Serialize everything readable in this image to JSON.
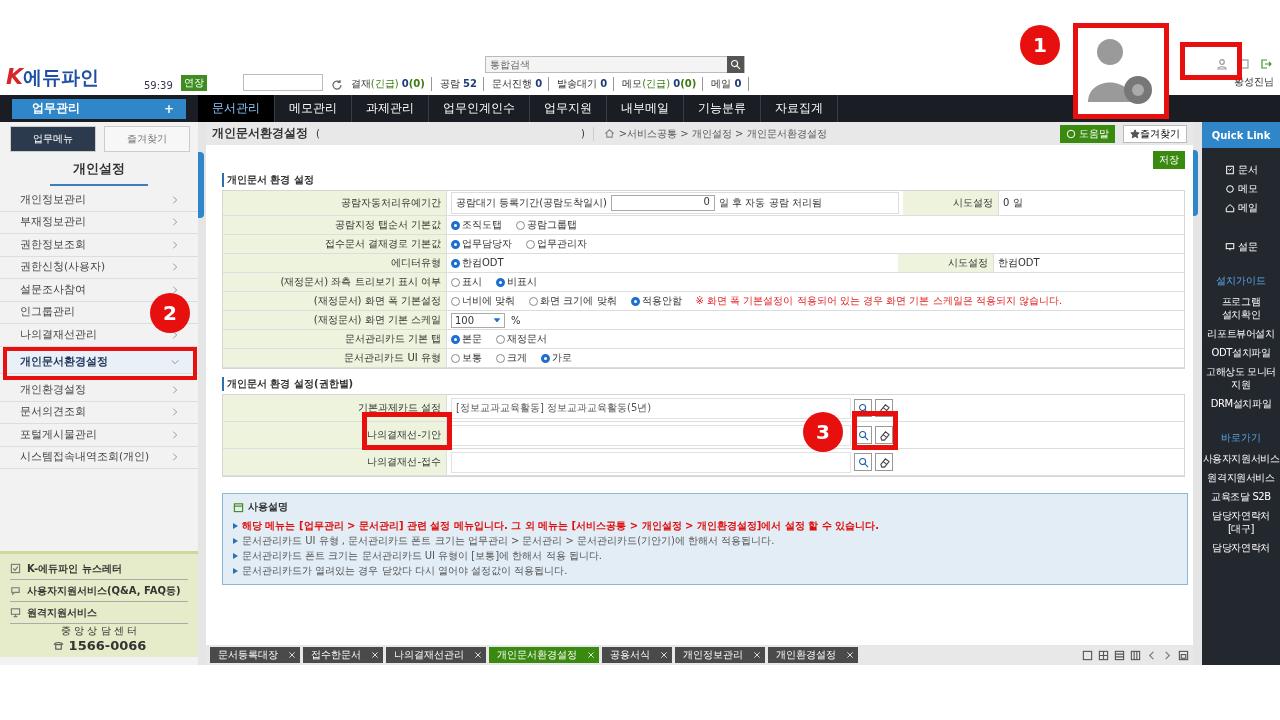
{
  "header": {
    "logo_k": "K",
    "logo": "에듀파인",
    "timer": "59:39",
    "extend": "연장",
    "search_placeholder": "통합검색",
    "status": [
      {
        "label": "결재",
        "urgent": "(긴급)",
        "count": "0",
        "sub": "(0)"
      },
      {
        "label": "공람",
        "count": "52"
      },
      {
        "label": "문서진행",
        "count": "0"
      },
      {
        "label": "발송대기",
        "count": "0"
      },
      {
        "label": "메모",
        "urgent": "(긴급)",
        "count": "0",
        "sub": "(0)"
      },
      {
        "label": "메일",
        "count": "0"
      }
    ],
    "user": "황성진님"
  },
  "nav": {
    "main_button": "업무관리",
    "plus": "+",
    "items": [
      {
        "label": "문서관리",
        "selected": true
      },
      {
        "label": "메모관리",
        "selected": false
      },
      {
        "label": "과제관리",
        "selected": false
      },
      {
        "label": "업무인계인수",
        "selected": false
      },
      {
        "label": "업무지원",
        "selected": false
      },
      {
        "label": "내부메일",
        "selected": false
      },
      {
        "label": "기능분류",
        "selected": false
      },
      {
        "label": "자료집계",
        "selected": false
      }
    ]
  },
  "sidebar": {
    "tabs": [
      {
        "label": "업무메뉴",
        "selected": true
      },
      {
        "label": "즐겨찾기",
        "selected": false
      }
    ],
    "title": "개인설정",
    "items": [
      {
        "label": "개인정보관리",
        "selected": false
      },
      {
        "label": "부재정보관리",
        "selected": false
      },
      {
        "label": "권한정보조회",
        "selected": false
      },
      {
        "label": "권한신청(사용자)",
        "selected": false
      },
      {
        "label": "설문조사참여",
        "selected": false
      },
      {
        "label": "인그룹관리",
        "selected": false
      },
      {
        "label": "나의결재선관리",
        "selected": false
      },
      {
        "label": "개인문서환경설정",
        "selected": true
      },
      {
        "label": "개인환경설정",
        "selected": false
      },
      {
        "label": "문서의견조회",
        "selected": false
      },
      {
        "label": "포털게시물관리",
        "selected": false
      },
      {
        "label": "시스템접속내역조회(개인)",
        "selected": false
      }
    ],
    "links": [
      {
        "label": "K-에듀파인 뉴스레터",
        "kind": "news"
      },
      {
        "label": "사용자지원서비스(Q&A, FAQ등)",
        "kind": "chat"
      },
      {
        "label": "원격지원서비스",
        "kind": "remote"
      }
    ],
    "center_label": "중 앙 상 담 센 터",
    "phone": "1566-0066"
  },
  "page": {
    "title": "개인문서환경설정",
    "paren_open": "(",
    "paren_close": ")",
    "breadcrumb": ">서비스공통 > 개인설정 > 개인문서환경설정",
    "help": "도움말",
    "favorite": "즐겨찾기",
    "save": "저장"
  },
  "section1": {
    "title": "개인문서 환경 설정",
    "rows": [
      {
        "kind": "period",
        "label": "공람자동처리유예기간",
        "prefix": "공람대기 등록기간(공람도착일시)",
        "value": "0",
        "suffix": "일 후 자동 공람 처리됨",
        "side_label": "시도설정",
        "side_value": "0 일"
      },
      {
        "kind": "radio",
        "label": "공람지정 탭순서 기본값",
        "options": [
          {
            "label": "조직도탭",
            "selected": true
          },
          {
            "label": "공람그룹탭",
            "selected": false
          }
        ]
      },
      {
        "kind": "radio",
        "label": "접수문서 결재경로 기본값",
        "options": [
          {
            "label": "업무담당자",
            "selected": true
          },
          {
            "label": "업무관리자",
            "selected": false
          }
        ]
      },
      {
        "kind": "radio",
        "label": "에디터유형",
        "options": [
          {
            "label": "한컴ODT",
            "selected": true
          }
        ],
        "side_label": "시도설정",
        "side_value": "한컴ODT"
      },
      {
        "kind": "radio",
        "label": "(재정문서) 좌측 트리보기 표시 여부",
        "options": [
          {
            "label": "표시",
            "selected": false
          },
          {
            "label": "비표시",
            "selected": true
          }
        ]
      },
      {
        "kind": "radio",
        "label": "(재정문서) 화면 폭 기본설정",
        "options": [
          {
            "label": "너비에 맞춰",
            "selected": false
          },
          {
            "label": "화면 크기에 맞춰",
            "selected": false
          },
          {
            "label": "적용안함",
            "selected": true
          }
        ],
        "note": "※ 화면 폭 기본설정이 적용되어 있는 경우 화면 기본 스케일은 적용되지 않습니다."
      },
      {
        "kind": "select",
        "label": "(재정문서) 화면 기본 스케일",
        "value": "100",
        "unit": "%"
      },
      {
        "kind": "radio",
        "label": "문서관리카드 기본 탭",
        "options": [
          {
            "label": "본문",
            "selected": true
          },
          {
            "label": "재정문서",
            "selected": false
          }
        ]
      },
      {
        "kind": "radio",
        "label": "문서관리카드 UI 유형",
        "options": [
          {
            "label": "보통",
            "selected": false
          },
          {
            "label": "크게",
            "selected": false
          },
          {
            "label": "가로",
            "selected": true
          }
        ]
      }
    ]
  },
  "section2": {
    "title": "개인문서 환경 설정(권한별)",
    "rows": [
      {
        "label": "기본과제카드 설정",
        "value": "[정보교과교육활동] 정보교과교육활동(5년)"
      },
      {
        "label": "나의결재선-기안"
      },
      {
        "label": "나의결재선-접수"
      }
    ]
  },
  "info": {
    "title": "사용설명",
    "lines": [
      {
        "text": "해당 메뉴는 [업무관리 > 문서관리] 관련 설정 메뉴입니다. 그 외 메뉴는 [서비스공통 > 개인설정 > 개인환경설정]에서 설정 할 수 있습니다.",
        "emphasis": true
      },
      {
        "text": "문서관리카드 UI 유형 , 문서관리카드 폰트 크기는 업무관리 > 문서관리 > 문서관리카드(기안기)에 한해서 적용됩니다.",
        "emphasis": false
      },
      {
        "text": "문서관리카드 폰트 크기는 문서관리카드 UI 유형이 [보통]에 한해서 적용 됩니다.",
        "emphasis": false
      },
      {
        "text": "문서관리카드가 열려있는 경우 닫았다 다시 열어야 설정값이 적용됩니다.",
        "emphasis": false
      }
    ]
  },
  "bottom_tabs": [
    {
      "label": "문서등록대장",
      "selected": false
    },
    {
      "label": "접수한문서",
      "selected": false
    },
    {
      "label": "나의결재선관리",
      "selected": false
    },
    {
      "label": "개인문서환경설정",
      "selected": true
    },
    {
      "label": "공용서식",
      "selected": false
    },
    {
      "label": "개인정보관리",
      "selected": false
    },
    {
      "label": "개인환경설정",
      "selected": false
    }
  ],
  "quick_link": {
    "title": "Quick Link",
    "items": [
      {
        "label": "문서",
        "kind": "doc"
      },
      {
        "label": "메모",
        "kind": "memo"
      },
      {
        "label": "메일",
        "kind": "mail"
      },
      {
        "label": "설문",
        "kind": "survey"
      }
    ],
    "groups": [
      {
        "title": "설치가이드",
        "items": [
          "프로그램 설치확인",
          "리포트뷰어설치",
          "ODT설치파일",
          "고해상도 모니터 지원",
          "DRM설치파일"
        ]
      },
      {
        "title": "바로가기",
        "items": [
          "사용자지원서비스",
          "원격지원서비스",
          "교육조달 S2B",
          "담당자연락처 [대구]",
          "담당자연락처"
        ]
      }
    ]
  },
  "annotations": [
    "1",
    "2",
    "3"
  ]
}
